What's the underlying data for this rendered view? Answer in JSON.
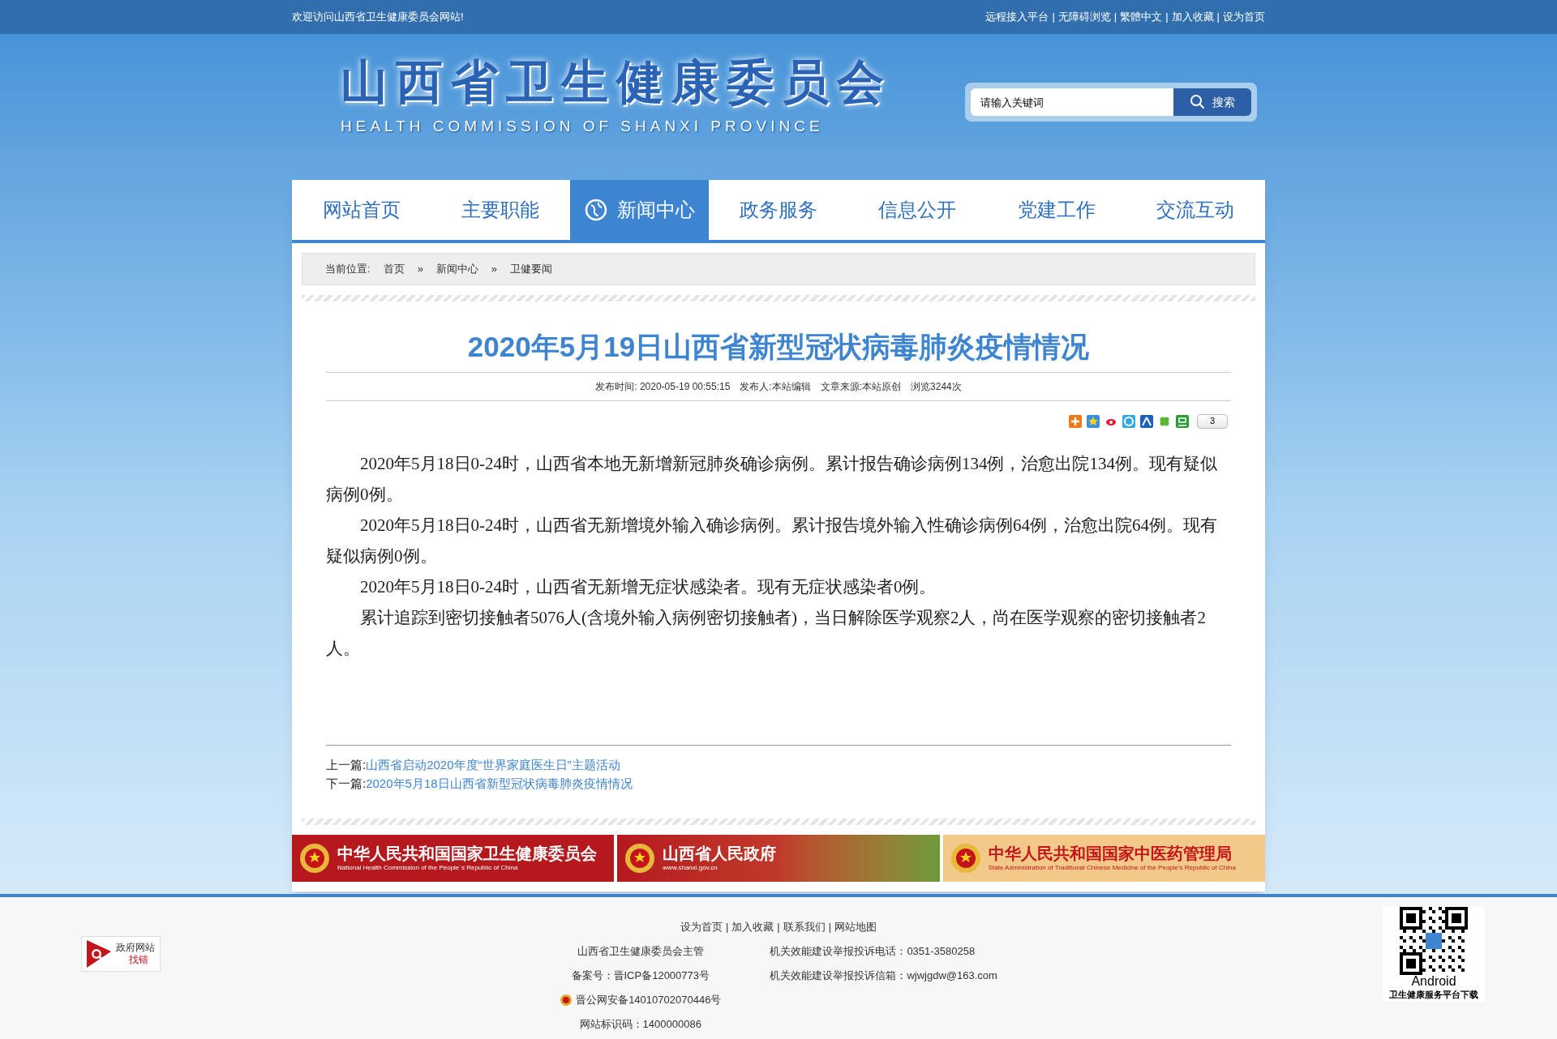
{
  "top_bar": {
    "welcome": "欢迎访问山西省卫生健康委员会网站!",
    "links": [
      "远程接入平台",
      "无障碍浏览",
      "繁體中文",
      "加入收藏",
      "设为首页"
    ],
    "separator": "|"
  },
  "header": {
    "logo_title": "山西省卫生健康委员会",
    "logo_subtitle": "HEALTH COMMISSION OF SHANXI PROVINCE",
    "search": {
      "placeholder": "请输入关键词",
      "button": "搜索"
    }
  },
  "nav": [
    {
      "label": "网站首页",
      "selected": false
    },
    {
      "label": "主要职能",
      "selected": false
    },
    {
      "label": "新闻中心",
      "selected": true
    },
    {
      "label": "政务服务",
      "selected": false
    },
    {
      "label": "信息公开",
      "selected": false
    },
    {
      "label": "党建工作",
      "selected": false
    },
    {
      "label": "交流互动",
      "selected": false
    }
  ],
  "breadcrumb": {
    "label": "当前位置:",
    "items": [
      "首页",
      "新闻中心",
      "卫健要闻"
    ],
    "separator": "»"
  },
  "article": {
    "title": "2020年5月19日山西省新型冠状病毒肺炎疫情情况",
    "meta": [
      "发布时间: 2020-05-19 00:55:15",
      "发布人:本站编辑",
      "文章来源:本站原创",
      "浏览3244次"
    ],
    "share_count": "3",
    "paragraphs": [
      "2020年5月18日0-24时，山西省本地无新增新冠肺炎确诊病例。累计报告确诊病例134例，治愈出院134例。现有疑似病例0例。",
      "2020年5月18日0-24时，山西省无新增境外输入确诊病例。累计报告境外输入性确诊病例64例，治愈出院64例。现有疑似病例0例。",
      "2020年5月18日0-24时，山西省无新增无症状感染者。现有无症状感染者0例。",
      "累计追踪到密切接触者5076人(含境外输入病例密切接触者)，当日解除医学观察2人，尚在医学观察的密切接触者2人。"
    ],
    "prev": {
      "label": "上一篇:",
      "title": "山西省启动2020年度“世界家庭医生日”主题活动"
    },
    "next": {
      "label": "下一篇:",
      "title": "2020年5月18日山西省新型冠状病毒肺炎疫情情况"
    }
  },
  "banners": [
    {
      "title": "中华人民共和国国家卫生健康委员会",
      "subtitle": "National Health Commission of the People´s Republic of China"
    },
    {
      "title": "山西省人民政府",
      "subtitle": "www.shanxi.gov.cn"
    },
    {
      "title": "中华人民共和国国家中医药管理局",
      "subtitle": "State Administration of Traditional Chinese Medicine of the People's Republic of China"
    }
  ],
  "footer": {
    "links": [
      "设为首页",
      "加入收藏",
      "联系我们",
      "网站地图"
    ],
    "separator": "|",
    "left": [
      "山西省卫生健康委员会主管",
      "备案号：晋ICP备12000773号",
      "晋公网安备14010702070446号",
      "网站标识码：1400000086"
    ],
    "right": [
      "机关效能建设举报投诉电话：0351-3580258",
      "机关效能建设举报投诉信箱：wjwjgdw@163.com"
    ],
    "badge": {
      "line1": "政府网站",
      "line2": "找错"
    },
    "qr": {
      "caption": "Android",
      "subcaption": "卫生健康服务平台下载"
    }
  }
}
